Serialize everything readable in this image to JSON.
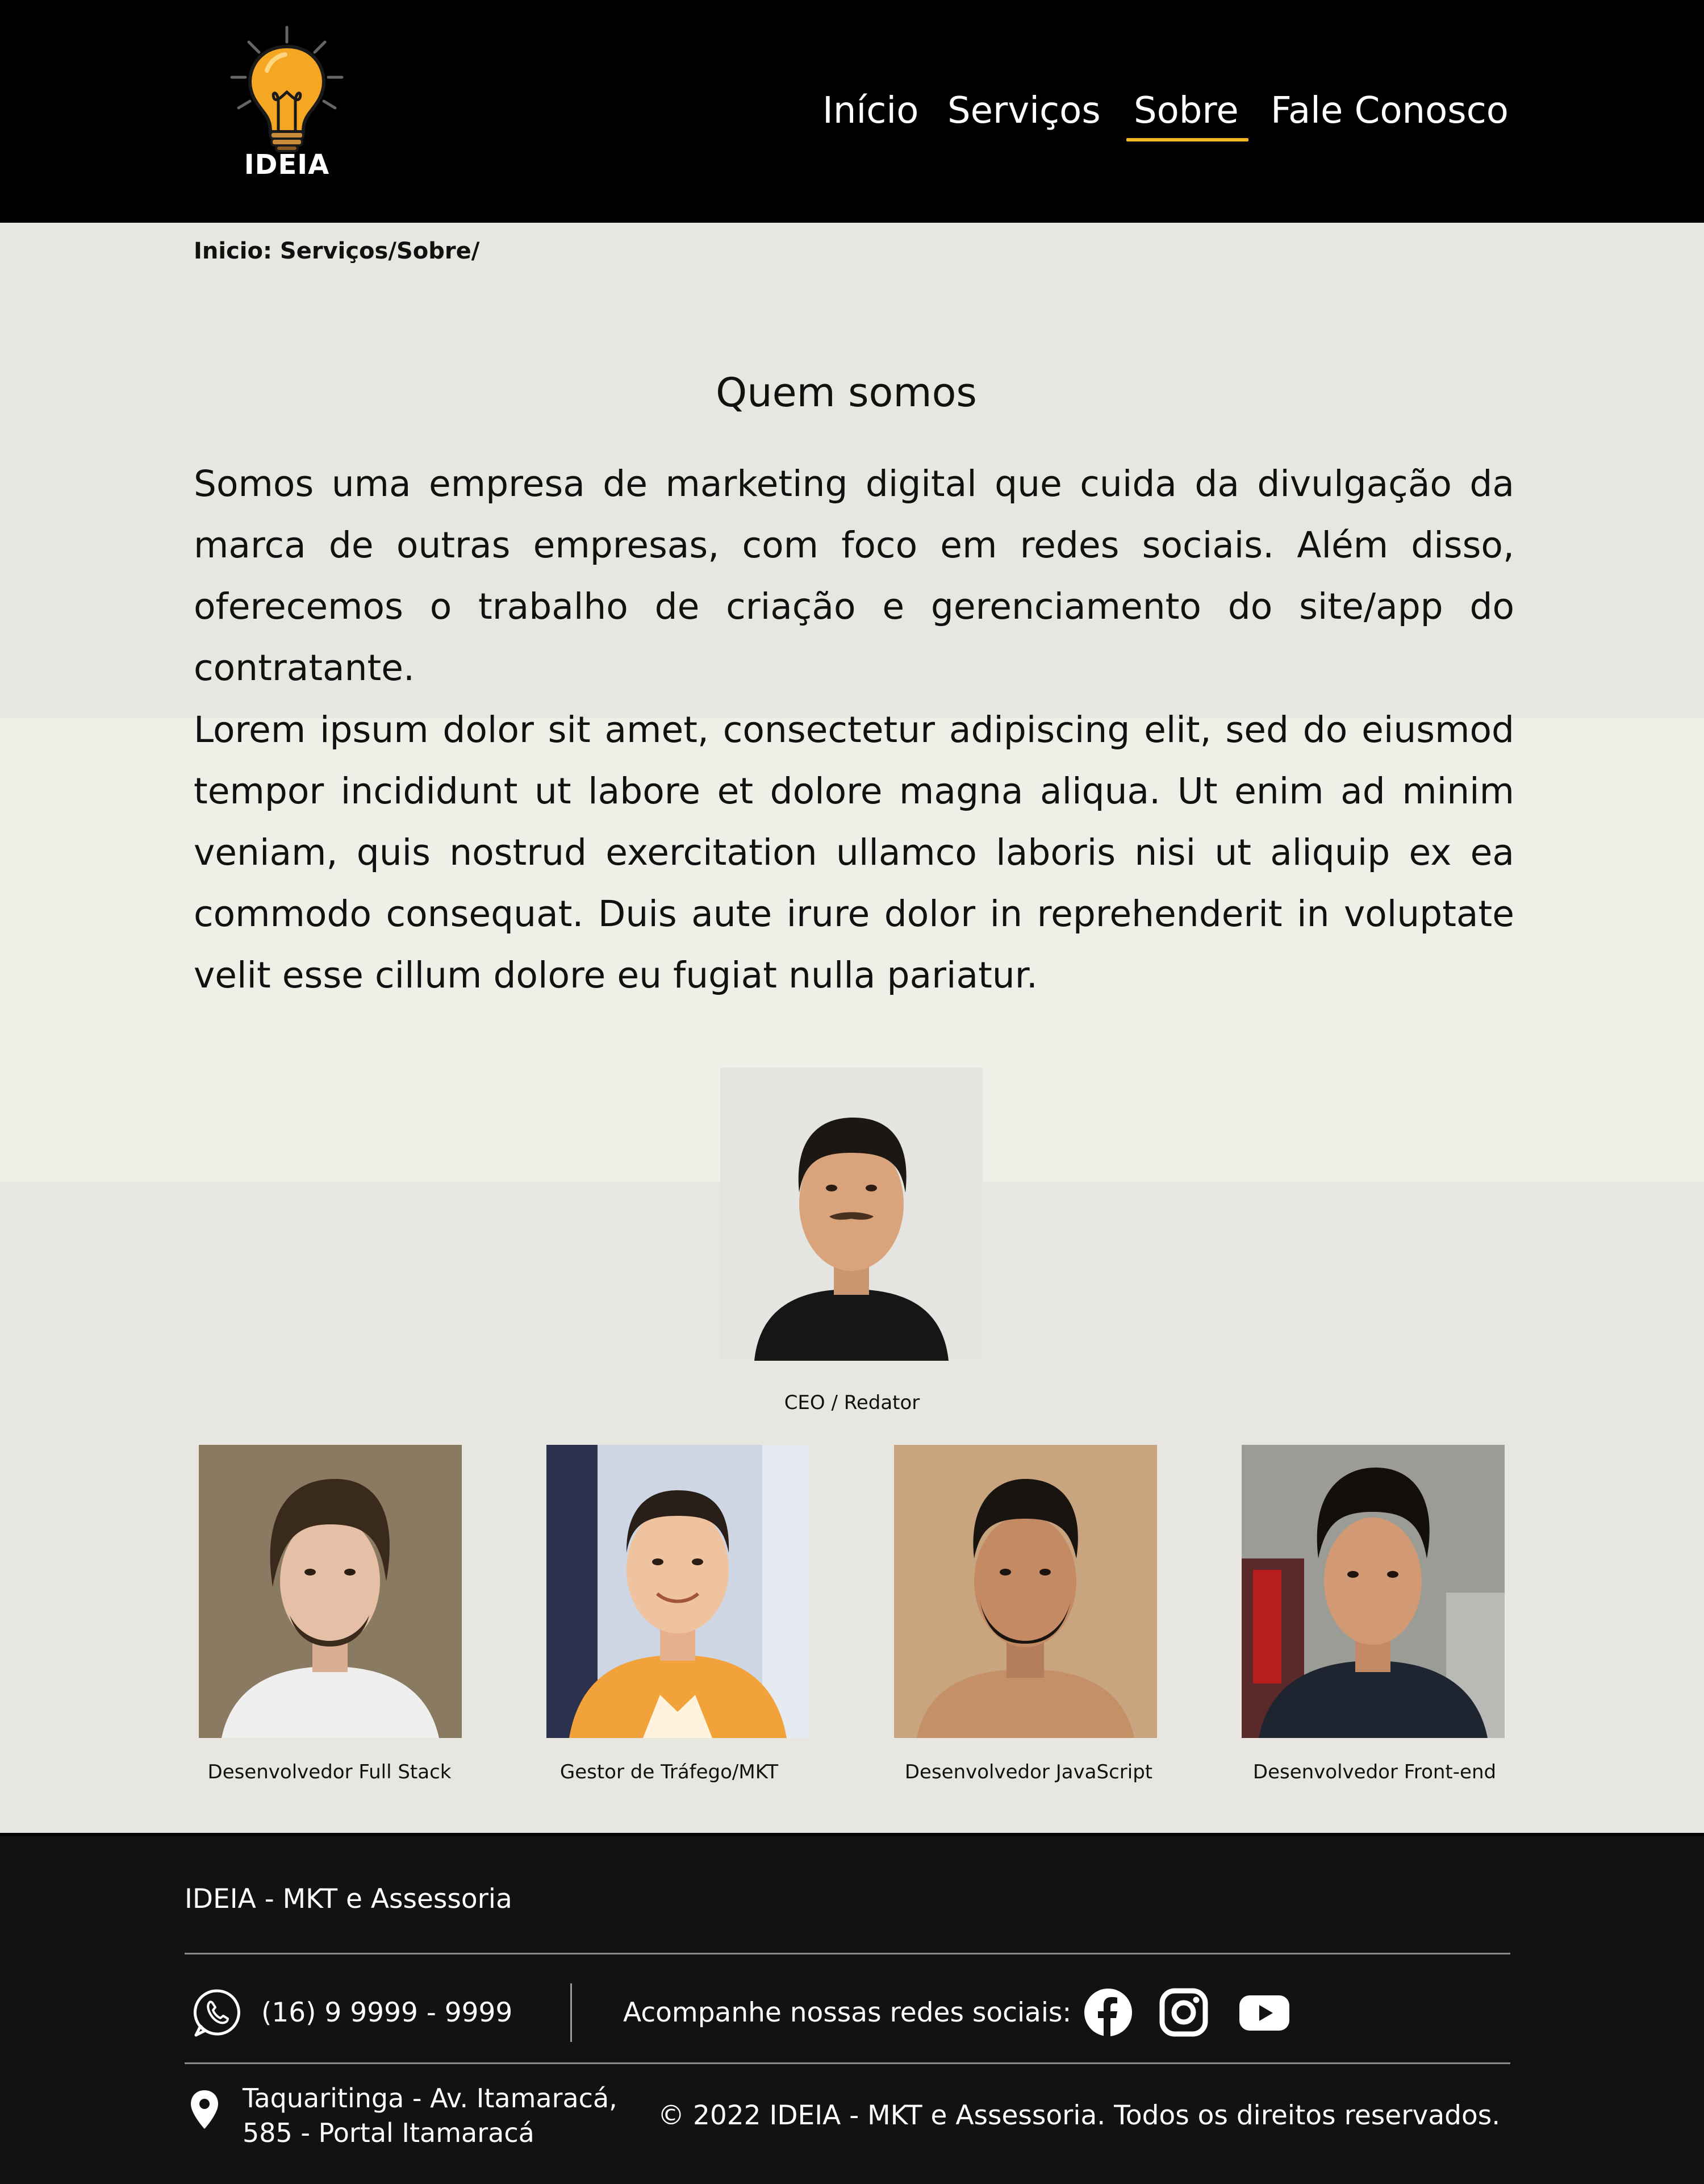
{
  "header": {
    "logo_text": "IDEIA",
    "nav": [
      {
        "label": "Início",
        "active": false
      },
      {
        "label": "Serviços",
        "active": false
      },
      {
        "label": "Sobre",
        "active": true
      },
      {
        "label": "Fale Conosco",
        "active": false
      }
    ],
    "accent_color": "#f2b824"
  },
  "breadcrumb": "Inicio: Serviços/Sobre/",
  "about": {
    "title": "Quem somos",
    "paragraph1": "Somos uma empresa de marketing digital que cuida da divulgação da marca de outras empresas, com foco em redes sociais. Além disso, oferecemos o trabalho de criação e gerenciamento do site/app do contratante.",
    "paragraph2": "Lorem ipsum dolor sit amet, consectetur adipiscing elit, sed do eiusmod tempor incididunt ut labore et dolore magna aliqua. Ut enim ad minim veniam, quis nostrud exercitation ullamco laboris nisi ut aliquip ex ea commodo consequat. Duis aute irure dolor in reprehenderit in voluptate velit esse cillum dolore eu fugiat nulla pariatur."
  },
  "team": {
    "lead": {
      "role": "CEO / Redator"
    },
    "members": [
      {
        "role": "Desenvolvedor Full Stack"
      },
      {
        "role": "Gestor de Tráfego/MKT"
      },
      {
        "role": "Desenvolvedor JavaScript"
      },
      {
        "role": "Desenvolvedor Front-end"
      }
    ]
  },
  "footer": {
    "brand": "IDEIA - MKT e Assessoria",
    "phone": "(16) 9 9999 - 9999",
    "social_label": "Acompanhe nossas redes sociais:",
    "social_icons": [
      "facebook-icon",
      "instagram-icon",
      "youtube-icon"
    ],
    "address_line1": "Taquaritinga - Av. Itamaracá,",
    "address_line2": "585 - Portal Itamaracá",
    "copyright": "© 2022 IDEIA - MKT e Assessoria. Todos os direitos reservados."
  }
}
